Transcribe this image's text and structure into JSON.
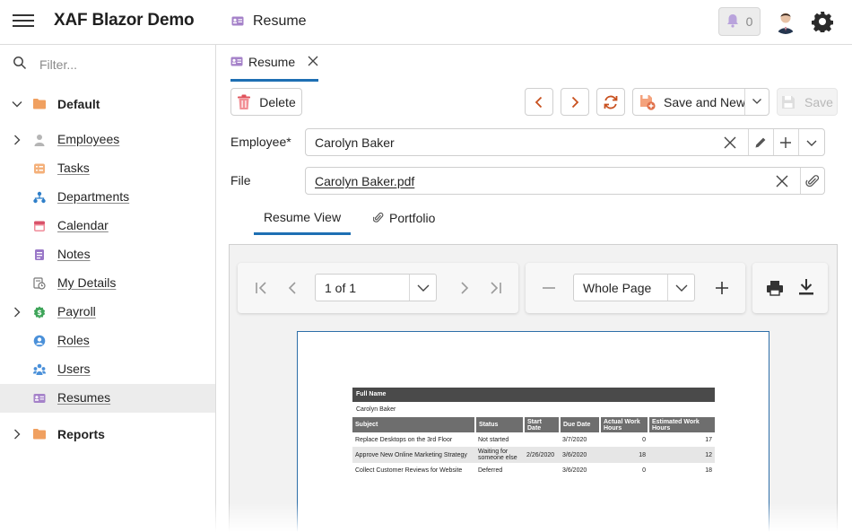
{
  "app": {
    "title": "XAF Blazor Demo",
    "view_title": "Resume",
    "notifications": "0"
  },
  "sidebar": {
    "filter_placeholder": "Filter...",
    "groups": [
      {
        "label": "Default",
        "expanded": true
      },
      {
        "label": "Reports",
        "expanded": false
      }
    ],
    "items": [
      {
        "label": "Employees",
        "icon": "employee-icon",
        "expandable": true
      },
      {
        "label": "Tasks",
        "icon": "tasks-icon"
      },
      {
        "label": "Departments",
        "icon": "departments-icon"
      },
      {
        "label": "Calendar",
        "icon": "calendar-icon"
      },
      {
        "label": "Notes",
        "icon": "notes-icon"
      },
      {
        "label": "My Details",
        "icon": "my-details-icon"
      },
      {
        "label": "Payroll",
        "icon": "payroll-icon",
        "expandable": true
      },
      {
        "label": "Roles",
        "icon": "roles-icon"
      },
      {
        "label": "Users",
        "icon": "users-icon"
      },
      {
        "label": "Resumes",
        "icon": "resumes-icon",
        "active": true
      }
    ]
  },
  "tab": {
    "label": "Resume"
  },
  "toolbar": {
    "delete": "Delete",
    "save_and_new": "Save and New",
    "save": "Save"
  },
  "form": {
    "employee_label": "Employee*",
    "employee_value": "Carolyn Baker",
    "file_label": "File",
    "file_value": "Carolyn Baker.pdf"
  },
  "subtabs": {
    "resume_view": "Resume View",
    "portfolio": "Portfolio"
  },
  "viewer": {
    "page_selector": "1 of 1",
    "zoom": "Whole Page"
  },
  "report": {
    "full_name_header": "Full Name",
    "full_name": "Carolyn Baker",
    "columns": [
      "Subject",
      "Status",
      "Start Date",
      "Due Date",
      "Actual Work Hours",
      "Estimated Work Hours"
    ],
    "rows": [
      [
        "Replace Desktops on the 3rd Floor",
        "Not started",
        "",
        "3/7/2020",
        "0",
        "17"
      ],
      [
        "Approve New Online Marketing Strategy",
        "Waiting for someone else",
        "2/26/2020",
        "3/6/2020",
        "18",
        "12"
      ],
      [
        "Collect Customer Reviews for Website",
        "Deferred",
        "",
        "3/6/2020",
        "0",
        "18"
      ]
    ]
  },
  "colors": {
    "accent": "#1e6fb3",
    "orange": "#c8501e",
    "folder": "#f0a060"
  }
}
